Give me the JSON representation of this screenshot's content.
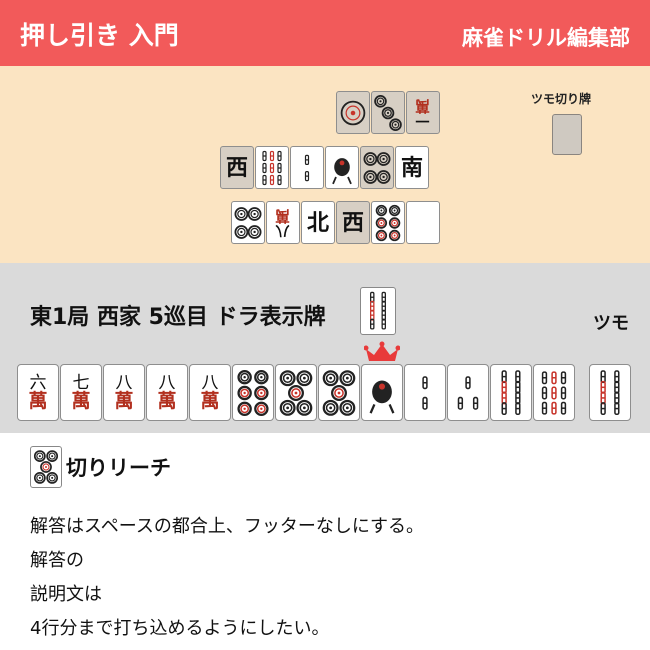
{
  "header": {
    "title": "押し引き 入門",
    "brand": "麻雀ドリル編集部"
  },
  "river": {
    "tsumogiri_label": "ツモ切り牌",
    "rows": [
      [
        {
          "kind": "pin",
          "n": 1,
          "tsumogiri": true
        },
        {
          "kind": "pin",
          "n": 3,
          "tsumogiri": true
        },
        {
          "kind": "char",
          "top": "一",
          "bottom": "萬",
          "tsumogiri": true,
          "rot": true
        }
      ],
      [
        {
          "kind": "char",
          "top": "西",
          "tsumogiri": true
        },
        {
          "kind": "sou",
          "n": 9
        },
        {
          "kind": "sou",
          "n": 2
        },
        {
          "kind": "sou",
          "n": 1
        },
        {
          "kind": "pin",
          "n": 4,
          "tsumogiri": true
        },
        {
          "kind": "char",
          "top": "南"
        }
      ],
      [
        {
          "kind": "pin",
          "n": 4
        },
        {
          "kind": "char",
          "top": "八",
          "bottom": "萬",
          "rot": true
        },
        {
          "kind": "char",
          "top": "北"
        },
        {
          "kind": "char",
          "top": "西",
          "tsumogiri": true
        },
        {
          "kind": "pin",
          "n": 6
        },
        {
          "kind": "blank"
        }
      ]
    ]
  },
  "status": {
    "round": "東1局 西家 5巡目 ドラ表示牌",
    "dora": {
      "kind": "sou",
      "n": 8
    },
    "tsumo_label": "ツモ"
  },
  "hand": [
    {
      "kind": "man",
      "top": "六"
    },
    {
      "kind": "man",
      "top": "七"
    },
    {
      "kind": "man",
      "top": "八"
    },
    {
      "kind": "man",
      "top": "八"
    },
    {
      "kind": "man",
      "top": "八"
    },
    {
      "kind": "pin",
      "n": 6
    },
    {
      "kind": "pin",
      "n": 5
    },
    {
      "kind": "pin",
      "n": 5
    },
    {
      "kind": "sou",
      "n": 1
    },
    {
      "kind": "sou",
      "n": 2
    },
    {
      "kind": "sou",
      "n": 3
    },
    {
      "kind": "sou",
      "n": 8
    },
    {
      "kind": "sou",
      "n": 9
    }
  ],
  "drawn": {
    "kind": "sou",
    "n": 8
  },
  "answer": {
    "tile": {
      "kind": "pin",
      "n": 5
    },
    "text": "切りリーチ",
    "lines": [
      "解答はスペースの都合上、フッターなしにする。",
      "解答の",
      "説明文は",
      "4行分まで打ち込めるようにしたい。"
    ]
  },
  "colors": {
    "header": "#f25a5a",
    "river_bg": "#fbe4c2",
    "status_bg": "#dadada",
    "crown": "#e83a3a",
    "red_pip": "#c7332a",
    "green": "#1f7a3a"
  }
}
